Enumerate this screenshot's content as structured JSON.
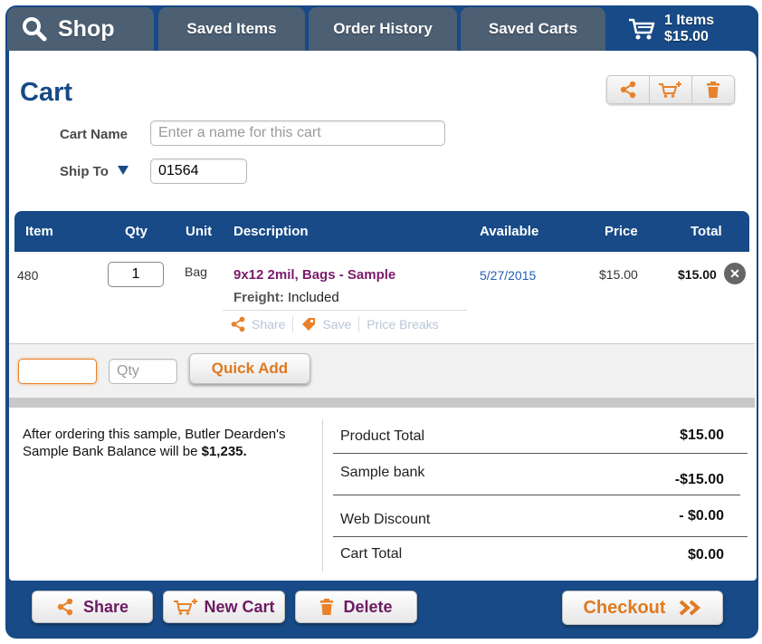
{
  "tabs": {
    "shop": "Shop",
    "saved_items": "Saved Items",
    "order_history": "Order History",
    "saved_carts": "Saved Carts",
    "cart_items": "1 Items",
    "cart_total": "$15.00"
  },
  "page_title": "Cart",
  "form": {
    "cart_name_label": "Cart Name",
    "cart_name_placeholder": "Enter a name for this cart",
    "cart_name_value": "",
    "ship_to_label": "Ship To",
    "ship_to_value": "01564"
  },
  "table": {
    "headers": {
      "item": "Item",
      "qty": "Qty",
      "unit": "Unit",
      "description": "Description",
      "available": "Available",
      "price": "Price",
      "total": "Total"
    },
    "rows": [
      {
        "item": "480",
        "qty": "1",
        "unit": "Bag",
        "description": "9x12 2mil, Bags - Sample",
        "freight_label": "Freight:",
        "freight_value": "Included",
        "available": "5/27/2015",
        "price": "$15.00",
        "total": "$15.00"
      }
    ],
    "row_actions": {
      "share": "Share",
      "save": "Save",
      "price_breaks": "Price Breaks"
    }
  },
  "quick_add": {
    "item_value": "",
    "qty_placeholder": "Qty",
    "button": "Quick Add"
  },
  "note": {
    "text": "After ordering this sample, Butler Dearden's Sample Bank Balance will be",
    "amount": "$1,235."
  },
  "summary": {
    "product_total_label": "Product Total",
    "product_total": "$15.00",
    "sample_bank_label": "Sample bank",
    "sample_bank": "-$15.00",
    "web_discount_label": "Web Discount",
    "web_discount": "- $0.00",
    "cart_total_label": "Cart Total",
    "cart_total": "$0.00"
  },
  "footer": {
    "share": "Share",
    "new_cart": "New Cart",
    "delete": "Delete",
    "checkout": "Checkout"
  },
  "colors": {
    "brand_blue": "#174a86",
    "accent_orange": "#e8822a",
    "purple_text": "#7b1b6b",
    "link_blue": "#1f5fb5"
  }
}
